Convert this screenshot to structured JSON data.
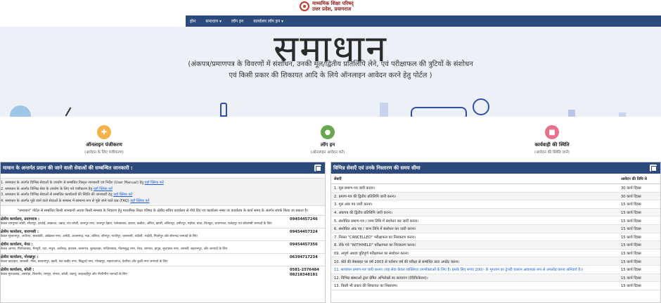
{
  "header": {
    "brand_line1": "माध्यमिक शिक्षा परिषद्",
    "brand_line2": "उत्तर प्रदेश, प्रयागराज"
  },
  "nav": {
    "items": [
      "होम",
      "समाधान ▾",
      "लॉग इन",
      "कार्यालय लॉग इन ▾"
    ]
  },
  "hero": {
    "title": "समाधान",
    "subtitle_line1": "(अंकपत्र/प्रमाणपत्र के विवरणों में संशोधन, उनकी मूल/द्वितीय प्रतिलिपि लेने, एवं परीक्षाफल की त्रुटियों के संशोधन",
    "subtitle_line2": "एवं किसी प्रकार की शिकायत आदि के लिये ऑनलाइन आवेदन करने हेतु पोर्टल )"
  },
  "actions": [
    {
      "title": "ऑनलाइन पंजीकरण",
      "sub": "(आवेदन के लिए पंजीकरण)",
      "icon": "user-plus-icon"
    },
    {
      "title": "लॉग इन",
      "sub": "(ऑनलाइन आवेदन करें)",
      "icon": "login-icon"
    },
    {
      "title": "कार्यवाही की स्थिति",
      "sub": "(आवेदन की स्थिति जानें)",
      "icon": "status-icon"
    }
  ],
  "left_panel": {
    "title": "माधान के अन्तर्गत प्रदान की जाने वाली सेवाओं की सम्बन्धित जानकारी :",
    "links": [
      {
        "text": "1. समाधान के अंतर्गत विभिन्न सेवाओं के उपयोग से सम्बंधित विस्तृत जानकारी एवं निर्देश (User Manual) हेतु",
        "link": "यहाँ क्लिक करें"
      },
      {
        "text": "2. समाधान के अंतर्गत विभिन्न सेवा के उपयोग के लिए नये पंजीकरण हेतु",
        "link": "यहाँ क्लिक करें"
      },
      {
        "text": "3. समाधान के अंतर्गत विभिन्न सेवाओं से सम्बंधित कार्यालयों की स्थिति की जानकारी हेतु",
        "link": "यहाँ क्लिक करें"
      },
      {
        "text": "4. समाधान के अंतर्गत पूछे जाने वाले सेवाओं के सम्बन्ध में सामान्य रूप से पूछे जाने वाले प्रश्न (FAQ)",
        "link": "यहाँ क्लिक करें"
      }
    ],
    "note": "\"समाधान\" पोर्टल से सम्बंधित किसी जानकारी अथवा किसी समस्या के निवारण हेतु माध्यमिक शिक्षा परिषद के क्षेत्रीय सचिव कार्यालय से नीचे दिए गए कार्यालय नम्बर पर कार्यालय के कार्य समय के अंतर्गत संपर्क किया जा सकता है।",
    "offices": [
      {
        "name": "क्षेत्रीय कार्यालय, प्रयागराज :",
        "districts": "केवल रामपुरवा कोठी, सीतापुर, हरदोई, लखनऊ, उन्नाव, राय बरेली, कानपुर नगर, कानपुर देहात, फर्रुखाबाद, इटावा, कन्नौज, औरैया, झांसी, ललितपुर, हमीरपुर, महोबा, बांदा, चित्रकूट, प्रयागराज, फतेहपुर एवं कौशाम्बी जनपदों के लिए",
        "phone": "09454457246"
      },
      {
        "name": "क्षेत्रीय कार्यालय, वाराणसी :",
        "districts": "केवल सुल्तानपुर, अयोध्या, बाराबंकी, अंबेडकर नगर, अमेठी, आजमगढ़, मऊ, बलिया, जौनपुर, गाजीपुर, वाराणसी, चंदौली, भदोही, मिर्ज़ापुर और सोनभद्र जनपदों के लिए",
        "phone": "09454457324"
      },
      {
        "name": "क्षेत्रीय कार्यालय, मेरठ :",
        "districts": "केवल आगरा, फिरोज़ाबाद, मैनपुरी, एटा, मथुरा, अलीगढ़, हाथरस, कासगंज, बुलंदशहर, गाज़ियाबाद, गौतमबुद्ध नगर, मेरठ, बागपत, हापुड़, मुज़फ्फर नगर, शामली, सहारनपुर, और जनपदों के लिए",
        "phone": "09454457356"
      },
      {
        "name": "क्षेत्रीय कार्यालय, गोरखपुर :",
        "districts": "केवल बहराइच, श्रावस्ती, गोंडा, बलरामपुर, बस्ती, संत कबीर नगर, सिद्धार्थ नगर, गोरखपुर, महाराजगंज, देवरिया और कुशी नगर जनपदों के लिए",
        "phone": "06394717234"
      },
      {
        "name": "क्षेत्रीय कार्यालय, बरेली :",
        "districts": "केवल मुरादाबाद, अमरोहा, बिजनौर, रामपुर, संभल, बरेली, बदायूं, शाहजहाँपुर और पीलीभीत जनपदों के लिए",
        "phone": "0581-2576484\n08218348181"
      }
    ]
  },
  "right_panel": {
    "title": "विभिन्न सेवाएँ एवं उनके निस्तारण की समय सीमा",
    "col_service": "सेवाएँ",
    "col_limit": "आवेदन की तिथि से",
    "rows": [
      {
        "service": "1. मूल प्रमाण-पत्र जारी करना।",
        "limit": "30 कार्य दिवस"
      },
      {
        "service": "2. प्रमाण-पत्र की द्वितीय प्रतिलिपि जारी करना।",
        "limit": "30 कार्य दिवस"
      },
      {
        "service": "3. मूल अंक पत्र जारी करना।",
        "limit": "15 कार्य दिवस"
      },
      {
        "service": "4. अंकपत्र की द्वितीय प्रतिलिपि जारी करना।",
        "limit": "15 कार्य दिवस"
      },
      {
        "service": "5. संशोधित प्रमाण-पत्र / जन्म तिथि में संशोधन कर जारी करना।",
        "limit": "15 कार्य दिवस"
      },
      {
        "service": "6. संशोधित अंक पत्र / जन्म तिथि में संशोधन कर जारी करना।",
        "limit": "15 कार्य दिवस"
      },
      {
        "service": "7. निरस्त \"CANCELLED\" परीक्षाफल का निराकरण करना।",
        "limit": "15 कार्य दिवस"
      },
      {
        "service": "8. रोके गये \"WITHHELD\" परीक्षाफल का निराकरण करना।",
        "limit": "15 कार्य दिवस"
      },
      {
        "service": "09. अपूर्ण अथवा त्रुटिपूर्ण परीक्षाफल का संशोधन करना।",
        "limit": "15 कार्य दिवस"
      },
      {
        "service": "10. बोर्ड की वेबसाइट पर वर्ष 2003 से वर्तमान वर्ष की परीक्षा से सम्बंधित डाटा अपडेट करना।",
        "limit": "15 कार्य दिवस"
      },
      {
        "service": "11. सत्यापन प्रमाण-पत्र जारी करना। (यह सेवा केवल व्यक्तिगत उपभोक्ताओं के लिए है। इसके लिए रूपए 200/- के भुगतान का ट्रेजरी चालान आवश्यक रूप से अपलोड करना अनिवार्य है।)",
        "limit": "15 कार्य दिवस"
      },
      {
        "service": "12. विभिन्न संस्थाओं द्वारा प्रेषित अभिलेखों का सत्यापन (वेरिफिकेशन)।",
        "limit": "15 कार्य दिवस"
      },
      {
        "service": "13. किसी भी प्रकार की शिकायत का निस्तारण।",
        "limit": "15 कार्य दिवस"
      }
    ]
  }
}
